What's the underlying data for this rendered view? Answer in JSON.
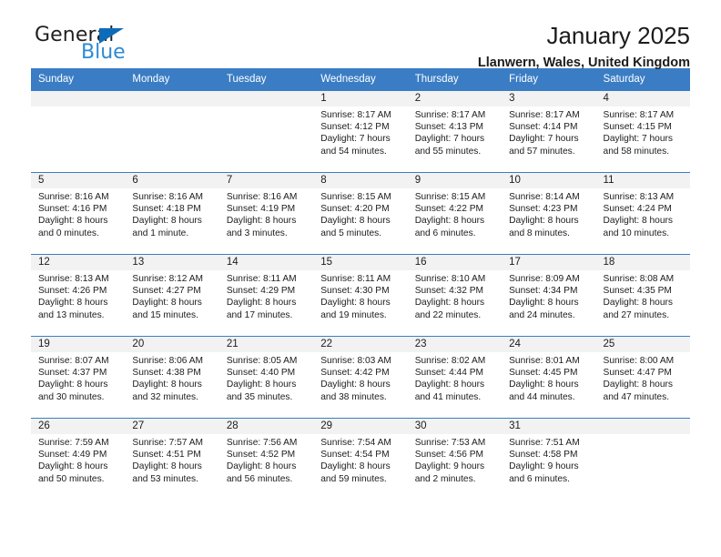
{
  "logo": {
    "word_one": "General",
    "word_two": "Blue",
    "triangle_color": "#0d6cb9",
    "blue_color": "#2e8ad4"
  },
  "header": {
    "title": "January 2025",
    "subtitle": "Llanwern, Wales, United Kingdom"
  },
  "theme": {
    "header_row_bg": "#3b7dc4",
    "daynum_band_bg": "#f2f2f2",
    "grid_line": "#3b7dc4",
    "text": "#1c1c1c"
  },
  "weekdays": [
    "Sunday",
    "Monday",
    "Tuesday",
    "Wednesday",
    "Thursday",
    "Friday",
    "Saturday"
  ],
  "weeks": [
    [
      {
        "day": "",
        "empty": true
      },
      {
        "day": "",
        "empty": true
      },
      {
        "day": "",
        "empty": true
      },
      {
        "day": "1",
        "sunrise": "Sunrise: 8:17 AM",
        "sunset": "Sunset: 4:12 PM",
        "daylight_1": "Daylight: 7 hours",
        "daylight_2": "and 54 minutes."
      },
      {
        "day": "2",
        "sunrise": "Sunrise: 8:17 AM",
        "sunset": "Sunset: 4:13 PM",
        "daylight_1": "Daylight: 7 hours",
        "daylight_2": "and 55 minutes."
      },
      {
        "day": "3",
        "sunrise": "Sunrise: 8:17 AM",
        "sunset": "Sunset: 4:14 PM",
        "daylight_1": "Daylight: 7 hours",
        "daylight_2": "and 57 minutes."
      },
      {
        "day": "4",
        "sunrise": "Sunrise: 8:17 AM",
        "sunset": "Sunset: 4:15 PM",
        "daylight_1": "Daylight: 7 hours",
        "daylight_2": "and 58 minutes."
      }
    ],
    [
      {
        "day": "5",
        "sunrise": "Sunrise: 8:16 AM",
        "sunset": "Sunset: 4:16 PM",
        "daylight_1": "Daylight: 8 hours",
        "daylight_2": "and 0 minutes."
      },
      {
        "day": "6",
        "sunrise": "Sunrise: 8:16 AM",
        "sunset": "Sunset: 4:18 PM",
        "daylight_1": "Daylight: 8 hours",
        "daylight_2": "and 1 minute."
      },
      {
        "day": "7",
        "sunrise": "Sunrise: 8:16 AM",
        "sunset": "Sunset: 4:19 PM",
        "daylight_1": "Daylight: 8 hours",
        "daylight_2": "and 3 minutes."
      },
      {
        "day": "8",
        "sunrise": "Sunrise: 8:15 AM",
        "sunset": "Sunset: 4:20 PM",
        "daylight_1": "Daylight: 8 hours",
        "daylight_2": "and 5 minutes."
      },
      {
        "day": "9",
        "sunrise": "Sunrise: 8:15 AM",
        "sunset": "Sunset: 4:22 PM",
        "daylight_1": "Daylight: 8 hours",
        "daylight_2": "and 6 minutes."
      },
      {
        "day": "10",
        "sunrise": "Sunrise: 8:14 AM",
        "sunset": "Sunset: 4:23 PM",
        "daylight_1": "Daylight: 8 hours",
        "daylight_2": "and 8 minutes."
      },
      {
        "day": "11",
        "sunrise": "Sunrise: 8:13 AM",
        "sunset": "Sunset: 4:24 PM",
        "daylight_1": "Daylight: 8 hours",
        "daylight_2": "and 10 minutes."
      }
    ],
    [
      {
        "day": "12",
        "sunrise": "Sunrise: 8:13 AM",
        "sunset": "Sunset: 4:26 PM",
        "daylight_1": "Daylight: 8 hours",
        "daylight_2": "and 13 minutes."
      },
      {
        "day": "13",
        "sunrise": "Sunrise: 8:12 AM",
        "sunset": "Sunset: 4:27 PM",
        "daylight_1": "Daylight: 8 hours",
        "daylight_2": "and 15 minutes."
      },
      {
        "day": "14",
        "sunrise": "Sunrise: 8:11 AM",
        "sunset": "Sunset: 4:29 PM",
        "daylight_1": "Daylight: 8 hours",
        "daylight_2": "and 17 minutes."
      },
      {
        "day": "15",
        "sunrise": "Sunrise: 8:11 AM",
        "sunset": "Sunset: 4:30 PM",
        "daylight_1": "Daylight: 8 hours",
        "daylight_2": "and 19 minutes."
      },
      {
        "day": "16",
        "sunrise": "Sunrise: 8:10 AM",
        "sunset": "Sunset: 4:32 PM",
        "daylight_1": "Daylight: 8 hours",
        "daylight_2": "and 22 minutes."
      },
      {
        "day": "17",
        "sunrise": "Sunrise: 8:09 AM",
        "sunset": "Sunset: 4:34 PM",
        "daylight_1": "Daylight: 8 hours",
        "daylight_2": "and 24 minutes."
      },
      {
        "day": "18",
        "sunrise": "Sunrise: 8:08 AM",
        "sunset": "Sunset: 4:35 PM",
        "daylight_1": "Daylight: 8 hours",
        "daylight_2": "and 27 minutes."
      }
    ],
    [
      {
        "day": "19",
        "sunrise": "Sunrise: 8:07 AM",
        "sunset": "Sunset: 4:37 PM",
        "daylight_1": "Daylight: 8 hours",
        "daylight_2": "and 30 minutes."
      },
      {
        "day": "20",
        "sunrise": "Sunrise: 8:06 AM",
        "sunset": "Sunset: 4:38 PM",
        "daylight_1": "Daylight: 8 hours",
        "daylight_2": "and 32 minutes."
      },
      {
        "day": "21",
        "sunrise": "Sunrise: 8:05 AM",
        "sunset": "Sunset: 4:40 PM",
        "daylight_1": "Daylight: 8 hours",
        "daylight_2": "and 35 minutes."
      },
      {
        "day": "22",
        "sunrise": "Sunrise: 8:03 AM",
        "sunset": "Sunset: 4:42 PM",
        "daylight_1": "Daylight: 8 hours",
        "daylight_2": "and 38 minutes."
      },
      {
        "day": "23",
        "sunrise": "Sunrise: 8:02 AM",
        "sunset": "Sunset: 4:44 PM",
        "daylight_1": "Daylight: 8 hours",
        "daylight_2": "and 41 minutes."
      },
      {
        "day": "24",
        "sunrise": "Sunrise: 8:01 AM",
        "sunset": "Sunset: 4:45 PM",
        "daylight_1": "Daylight: 8 hours",
        "daylight_2": "and 44 minutes."
      },
      {
        "day": "25",
        "sunrise": "Sunrise: 8:00 AM",
        "sunset": "Sunset: 4:47 PM",
        "daylight_1": "Daylight: 8 hours",
        "daylight_2": "and 47 minutes."
      }
    ],
    [
      {
        "day": "26",
        "sunrise": "Sunrise: 7:59 AM",
        "sunset": "Sunset: 4:49 PM",
        "daylight_1": "Daylight: 8 hours",
        "daylight_2": "and 50 minutes."
      },
      {
        "day": "27",
        "sunrise": "Sunrise: 7:57 AM",
        "sunset": "Sunset: 4:51 PM",
        "daylight_1": "Daylight: 8 hours",
        "daylight_2": "and 53 minutes."
      },
      {
        "day": "28",
        "sunrise": "Sunrise: 7:56 AM",
        "sunset": "Sunset: 4:52 PM",
        "daylight_1": "Daylight: 8 hours",
        "daylight_2": "and 56 minutes."
      },
      {
        "day": "29",
        "sunrise": "Sunrise: 7:54 AM",
        "sunset": "Sunset: 4:54 PM",
        "daylight_1": "Daylight: 8 hours",
        "daylight_2": "and 59 minutes."
      },
      {
        "day": "30",
        "sunrise": "Sunrise: 7:53 AM",
        "sunset": "Sunset: 4:56 PM",
        "daylight_1": "Daylight: 9 hours",
        "daylight_2": "and 2 minutes."
      },
      {
        "day": "31",
        "sunrise": "Sunrise: 7:51 AM",
        "sunset": "Sunset: 4:58 PM",
        "daylight_1": "Daylight: 9 hours",
        "daylight_2": "and 6 minutes."
      },
      {
        "day": "",
        "empty": true
      }
    ]
  ]
}
